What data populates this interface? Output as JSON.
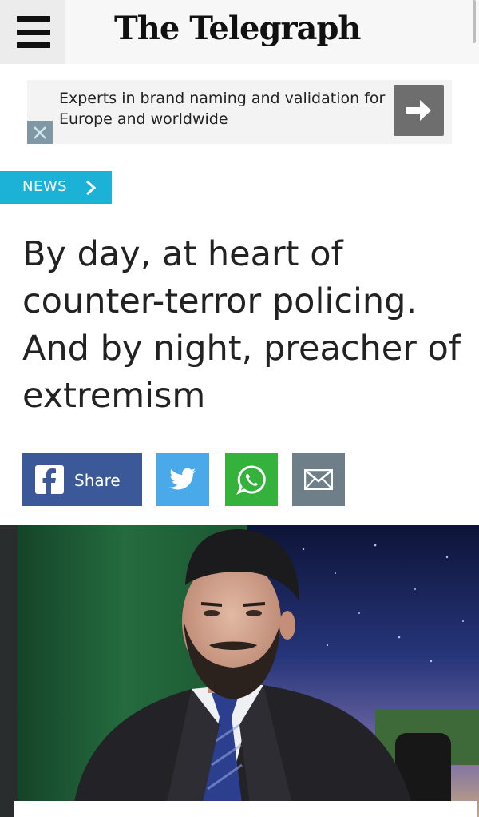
{
  "header": {
    "logo_text": "The Telegraph",
    "menu_icon": "hamburger-menu-icon"
  },
  "ad": {
    "text": "Experts in brand naming and validation for Europe and worldwide",
    "arrow_icon": "arrow-right-icon",
    "close_icon": "close-icon"
  },
  "section": {
    "label": "NEWS",
    "icon": "chevron-right-icon",
    "color": "#1cb1d6"
  },
  "article": {
    "headline": "By day, at heart of counter-terror policing. And by night, preacher of extremism"
  },
  "share": {
    "facebook_label": "Share",
    "colors": {
      "facebook": "#3b5998",
      "twitter": "#4aa9e8",
      "whatsapp": "#34b23c",
      "email": "#6e7f89"
    },
    "icons": [
      "facebook-icon",
      "twitter-icon",
      "whatsapp-icon",
      "email-icon"
    ]
  }
}
